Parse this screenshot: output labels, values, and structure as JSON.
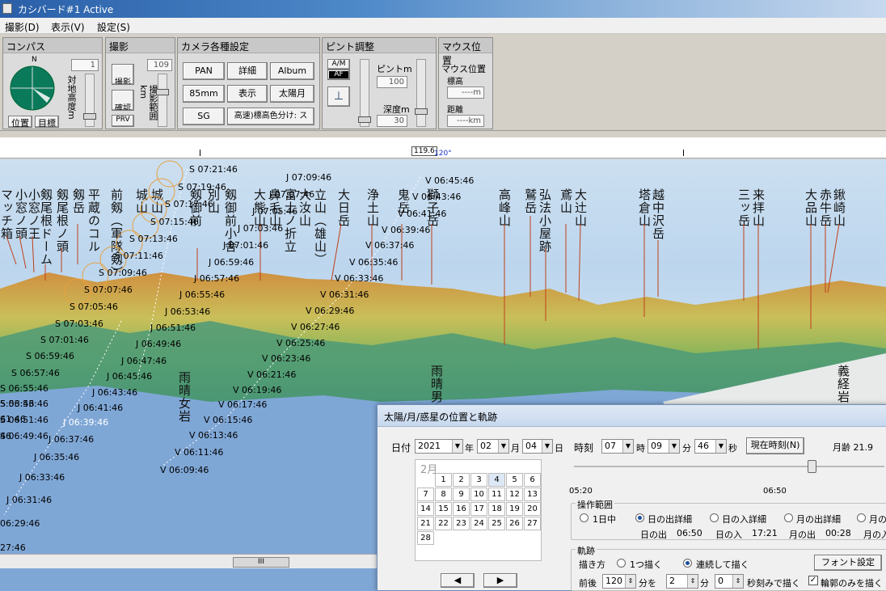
{
  "window": {
    "title": "カシバード#1 Active"
  },
  "menu": [
    "撮影(D)",
    "表示(V)",
    "設定(S)"
  ],
  "compass": {
    "title": "コンパス",
    "north": "N",
    "btn_pos": "位置",
    "btn_target": "目標",
    "value": "1",
    "height_label": "対地高度m"
  },
  "shoot": {
    "title": "撮影",
    "btn_shoot": "撮影",
    "btn_confirm": "確認",
    "btn_prv": "PRV",
    "range_label": "撮影範囲km",
    "value": "109"
  },
  "camera": {
    "title": "カメラ各種設定",
    "pan": "PAN",
    "detail": "詳細",
    "album": "Album",
    "mm": "85mm",
    "display": "表示",
    "sunmoon": "太陽月",
    "sg": "SG",
    "hispeed": "高速)標高色分け: ス"
  },
  "focus": {
    "title": "ピント調整",
    "am": "A/M",
    "af": "AF",
    "pinto": "ピントm",
    "pinto_val": "100",
    "depth": "深度m",
    "depth_val": "30"
  },
  "mouse": {
    "title": "マウス位置",
    "pos": "マウス位置",
    "alt": "標高",
    "alt_val": "----m",
    "dist": "距離",
    "dist_val": "----km"
  },
  "ruler": {
    "center": "119.6",
    "tick": "120°"
  },
  "peaks": [
    "マッチ箱",
    "小窓ノ頭",
    "小窓ノ王",
    "剱尾根ドーム",
    "剱尾根ノ頭",
    "剱岳",
    "平蔵のコル",
    "前剱（軍隊剱）",
    "城山",
    "城山",
    "剱御前",
    "別山",
    "剱御前小舎",
    "大熊山",
    "鼻毛山",
    "富士ノ折立",
    "立山（雄山）",
    "大汝山",
    "大日岳",
    "浄土山",
    "鬼岳",
    "獅子岳",
    "高峰山",
    "鷲岳",
    "弘法小屋跡",
    "鳶山",
    "大辻山",
    "塔倉山",
    "越中沢岳",
    "三ッ岳",
    "来拝山",
    "大品山",
    "赤牛岳",
    "鍬崎山",
    "義経岩",
    "雨晴女岩",
    "雨晴男岩"
  ],
  "sun_track": [
    "S 07:21:46",
    "S 07:19:46",
    "S 07:17:46",
    "S 07:15:46",
    "S 07:13:46",
    "S 07:11:46",
    "S 07:09:46",
    "S 07:07:46",
    "S 07:05:46",
    "S 07:03:46",
    "S 07:01:46",
    "S 06:59:46",
    "S 06:57:46",
    "S 06:55:46",
    "S 06:53:46",
    "S 06:51:46",
    "S 06:49:46"
  ],
  "jup_track": [
    "J 07:09:46",
    "J 07:07:46",
    "J 07:05:46",
    "J 07:03:46",
    "J 07:01:46",
    "J 06:59:46",
    "J 06:57:46",
    "J 06:55:46",
    "J 06:53:46",
    "J 06:51:46",
    "J 06:49:46",
    "J 06:47:46",
    "J 06:45:46",
    "J 06:43:46",
    "J 06:41:46",
    "J 06:39:46",
    "J 06:37:46",
    "J 06:35:46",
    "J 06:33:46",
    "J 06:31:46"
  ],
  "ven_track": [
    "V 06:45:46",
    "V 06:43:46",
    "V 06:41:46",
    "V 06:39:46",
    "V 06:37:46",
    "V 06:35:46",
    "V 06:33:46",
    "V 06:31:46",
    "V 06:29:46",
    "V 06:27:46",
    "V 06:25:46",
    "V 06:23:46",
    "V 06:21:46",
    "V 06:19:46",
    "V 06:17:46",
    "V 06:15:46",
    "V 06:13:46",
    "V 06:11:46",
    "V 06:09:46"
  ],
  "left_track": [
    "06:29:46",
    "27:46",
    "61:46",
    "5:53:46",
    "46"
  ],
  "scroll_thumb": "III",
  "dialog": {
    "title": "太陽/月/惑星の位置と軌跡",
    "date_label": "日付",
    "year": "2021",
    "year_unit": "年",
    "month": "02",
    "month_unit": "月",
    "day": "04",
    "day_unit": "日",
    "time_label": "時刻",
    "hour": "07",
    "hour_unit": "時",
    "min": "09",
    "min_unit": "分",
    "sec": "46",
    "sec_unit": "秒",
    "now_btn": "現在時刻(N)",
    "moon_age": "月齢 21.9",
    "cal_month": "2月",
    "cal_days": [
      "1",
      "2",
      "3",
      "4",
      "5",
      "6",
      "7",
      "8",
      "9",
      "10",
      "11",
      "12",
      "13",
      "14",
      "15",
      "16",
      "17",
      "18",
      "19",
      "20",
      "21",
      "22",
      "23",
      "24",
      "25",
      "26",
      "27",
      "28"
    ],
    "t_start": "05:20",
    "t_mid": "06:50",
    "range_title": "操作範囲",
    "r1": "1日中",
    "r2": "日の出詳細",
    "r3": "日の入詳細",
    "r4": "月の出詳細",
    "r5": "月の",
    "sunrise": "日の出",
    "sunrise_t": "06:50",
    "sunset": "日の入",
    "sunset_t": "17:21",
    "moonrise": "月の出",
    "moonrise_t": "00:28",
    "moonset": "月の入",
    "track_title": "軌跡",
    "draw_label": "描き方",
    "draw1": "1つ描く",
    "draw2": "連続して描く",
    "font_btn": "フォント設定",
    "before_after": "前後",
    "ba_val": "120",
    "ba_unit": "分を",
    "step_val": "2",
    "step_unit": "分",
    "sec_val": "0",
    "sec_step": "秒刻みで描く",
    "outline_only": "輪郭のみを描く"
  }
}
